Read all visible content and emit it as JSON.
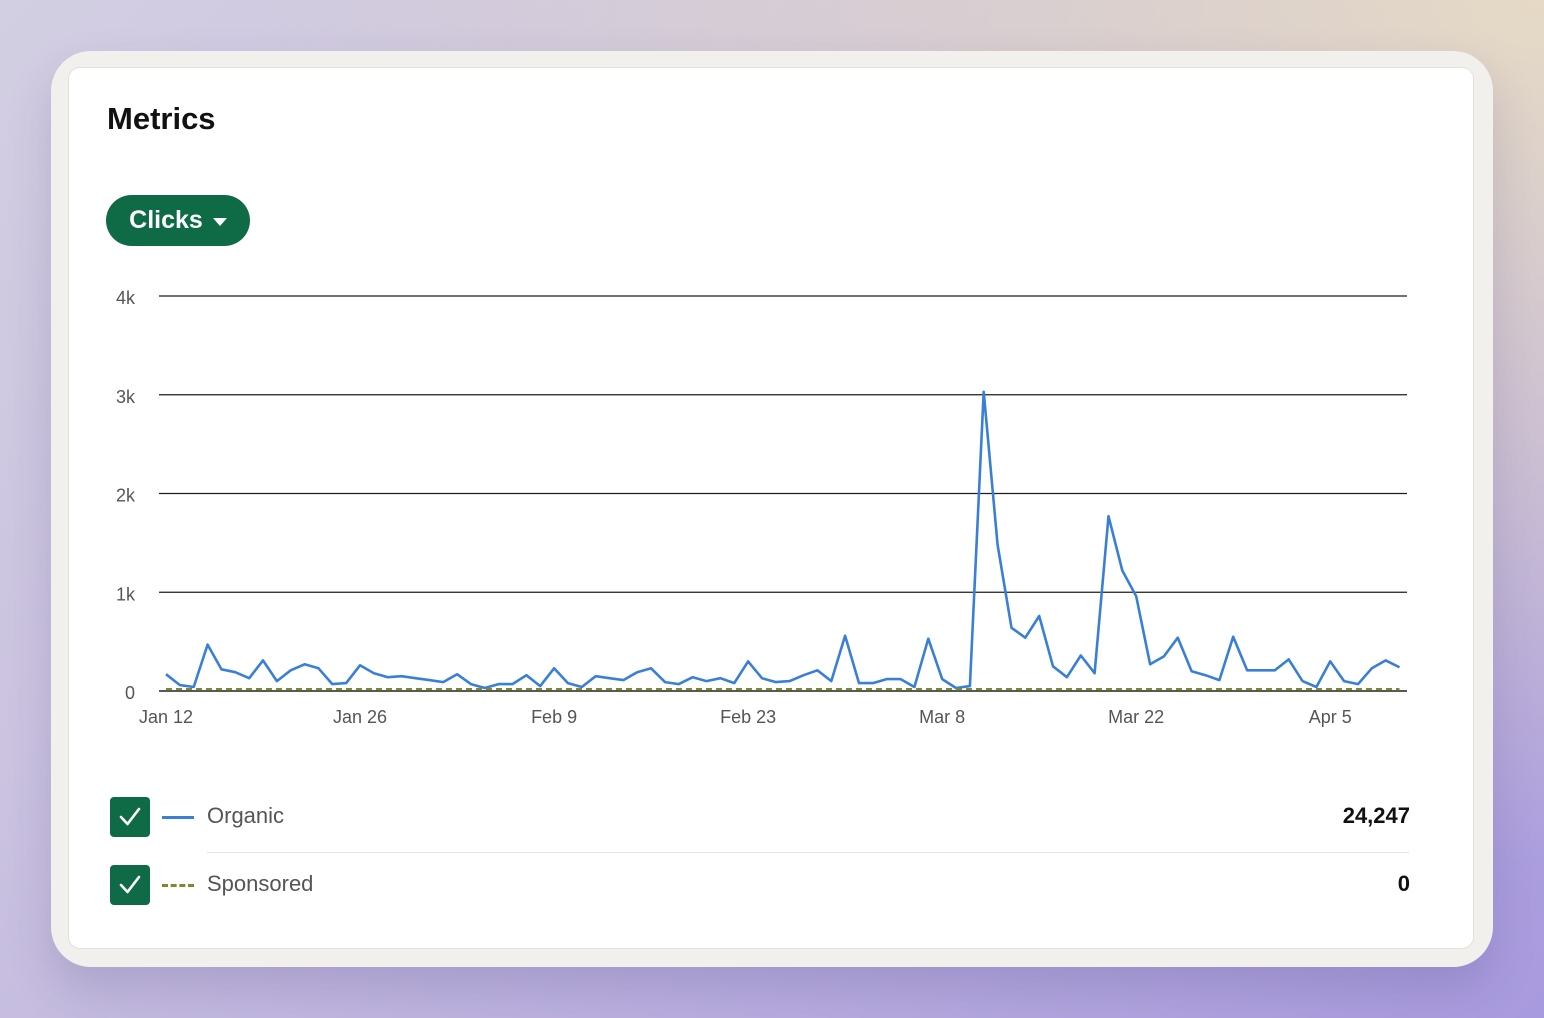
{
  "card": {
    "title": "Metrics"
  },
  "metric_selector": {
    "label": "Clicks"
  },
  "legend": [
    {
      "label": "Organic",
      "value": "24,247",
      "checked": true,
      "color": "#3a7fd6",
      "style": "solid"
    },
    {
      "label": "Sponsored",
      "value": "0",
      "checked": true,
      "color": "#7b8a2a",
      "style": "dashed"
    }
  ],
  "chart_data": {
    "type": "line",
    "x_labels": [
      "Jan 12",
      "Jan 26",
      "Feb 9",
      "Feb 23",
      "Mar 8",
      "Mar 22",
      "Apr 5"
    ],
    "y_ticks": [
      "0",
      "1k",
      "2k",
      "3k",
      "4k"
    ],
    "ylim": [
      0,
      4000
    ],
    "xlim": [
      "Jan 12",
      "Apr 12"
    ],
    "grid": true,
    "series": [
      {
        "name": "Organic",
        "color": "#3a7fd6",
        "style": "solid",
        "values": [
          170,
          60,
          40,
          470,
          220,
          190,
          130,
          310,
          100,
          210,
          270,
          230,
          70,
          80,
          260,
          180,
          140,
          150,
          130,
          110,
          90,
          170,
          70,
          30,
          70,
          70,
          160,
          50,
          230,
          80,
          40,
          150,
          130,
          110,
          190,
          230,
          90,
          70,
          140,
          100,
          130,
          80,
          300,
          130,
          90,
          100,
          160,
          210,
          100,
          560,
          80,
          80,
          120,
          120,
          40,
          530,
          120,
          30,
          50,
          3030,
          1480,
          640,
          540,
          760,
          250,
          140,
          360,
          180,
          1770,
          1220,
          960,
          270,
          350,
          540,
          200,
          160,
          110,
          550,
          210,
          210,
          210,
          320,
          100,
          40,
          300,
          100,
          70,
          230,
          310,
          240
        ]
      },
      {
        "name": "Sponsored",
        "color": "#7b8a2a",
        "style": "dashed",
        "values": [
          0,
          0
        ]
      }
    ]
  }
}
